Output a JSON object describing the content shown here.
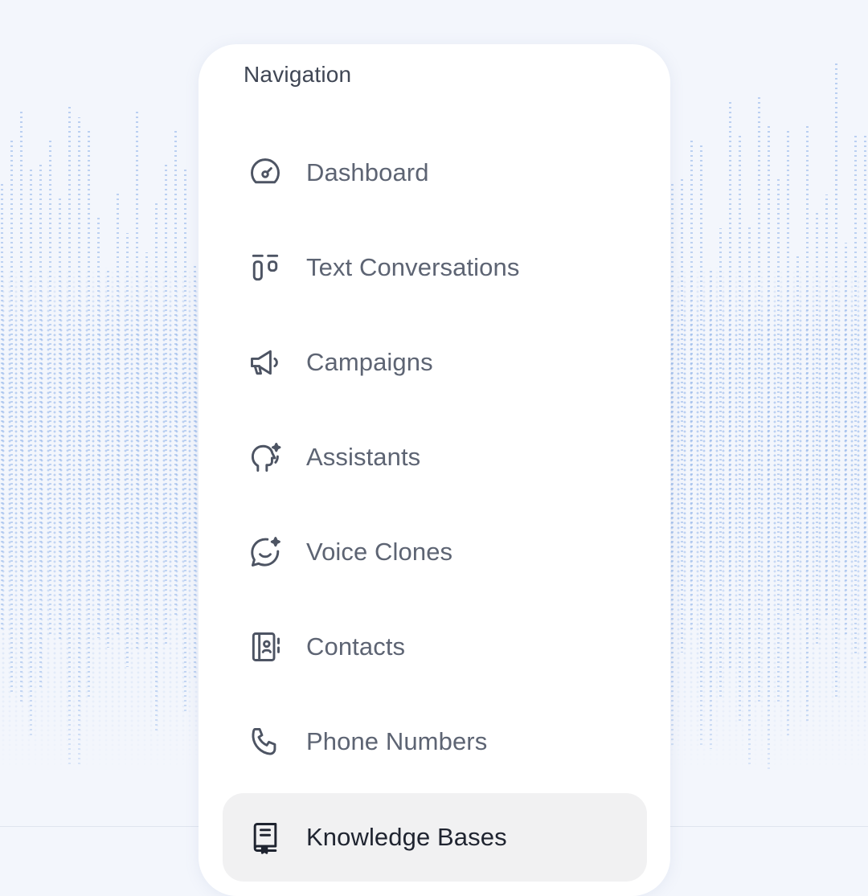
{
  "colors": {
    "page_background": "#f3f6fc",
    "dot_pattern": "#8aafe8",
    "panel_background": "#ffffff",
    "active_item_background": "#f1f1f2",
    "label_text": "#5d6473",
    "active_label_text": "#1f2430"
  },
  "navigation": {
    "heading": "Navigation",
    "items": [
      {
        "label": "Dashboard",
        "icon": "gauge-icon",
        "active": false
      },
      {
        "label": "Text Conversations",
        "icon": "columns-icon",
        "active": false
      },
      {
        "label": "Campaigns",
        "icon": "megaphone-icon",
        "active": false
      },
      {
        "label": "Assistants",
        "icon": "ai-head-icon",
        "active": false
      },
      {
        "label": "Voice Clones",
        "icon": "smile-sparkle-icon",
        "active": false
      },
      {
        "label": "Contacts",
        "icon": "contact-book-icon",
        "active": false
      },
      {
        "label": "Phone Numbers",
        "icon": "phone-icon",
        "active": false
      },
      {
        "label": "Knowledge Bases",
        "icon": "book-icon",
        "active": true
      }
    ]
  }
}
